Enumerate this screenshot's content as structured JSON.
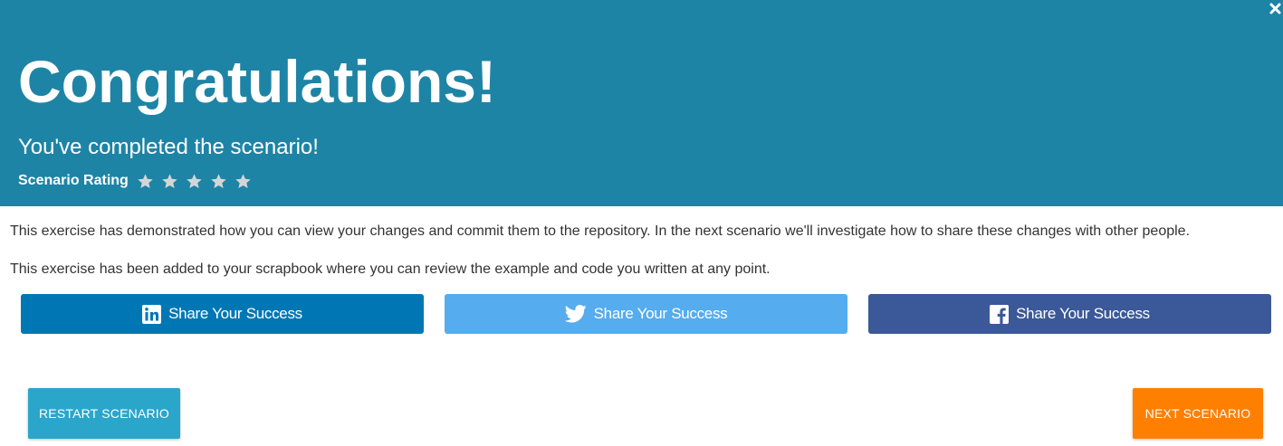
{
  "header": {
    "title": "Congratulations!",
    "subtitle": "You've completed the scenario!",
    "rating_label": "Scenario Rating",
    "rating_max": 5,
    "background_color": "#1e84a5",
    "close_icon": "close-icon"
  },
  "body": {
    "paragraph_1": "This exercise has demonstrated how you can view your changes and commit them to the repository. In the next scenario we'll investigate how to share these changes with other people.",
    "paragraph_2": "This exercise has been added to your scrapbook where you can review the example and code you written at any point."
  },
  "share_buttons": [
    {
      "label": "Share Your Success",
      "icon": "linkedin-icon",
      "color": "#0077b5"
    },
    {
      "label": "Share Your Success",
      "icon": "twitter-icon",
      "color": "#55acee"
    },
    {
      "label": "Share Your Success",
      "icon": "facebook-icon",
      "color": "#3b5998"
    }
  ],
  "actions": {
    "restart_label": "RESTART SCENARIO",
    "restart_color": "#2ba6cb",
    "next_label": "NEXT SCENARIO",
    "next_color": "#ff7f00"
  }
}
